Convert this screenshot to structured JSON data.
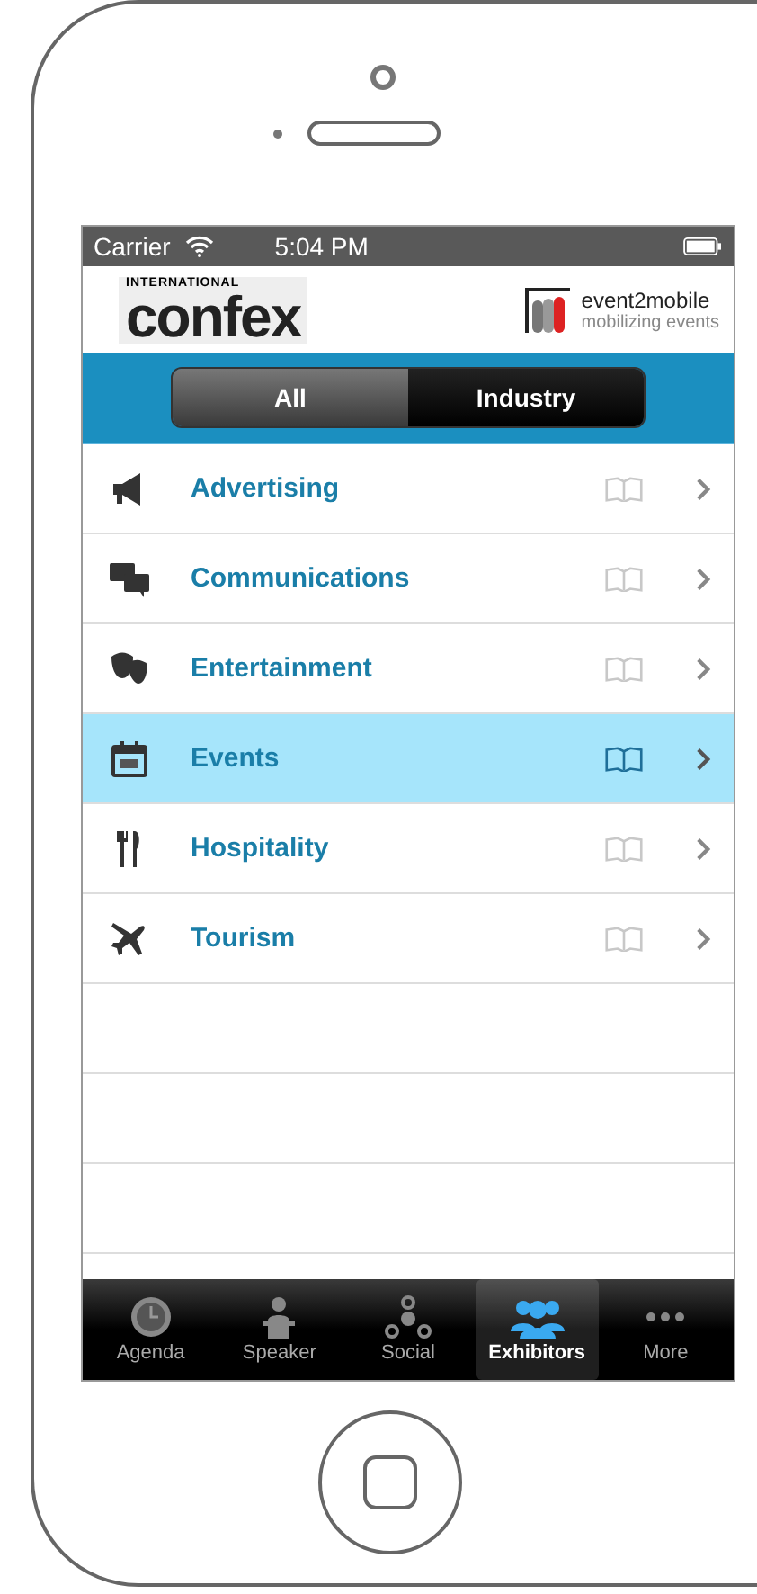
{
  "status_bar": {
    "carrier": "Carrier",
    "time": "5:04 PM"
  },
  "header": {
    "logo_small": "INTERNATIONAL",
    "logo_big": "confex",
    "partner_name": "event2mobile",
    "partner_tagline": "mobilizing events"
  },
  "segments": [
    {
      "label": "All",
      "selected": false
    },
    {
      "label": "Industry",
      "selected": true
    }
  ],
  "categories": [
    {
      "label": "Advertising",
      "selected": false
    },
    {
      "label": "Communications",
      "selected": false
    },
    {
      "label": "Entertainment",
      "selected": false
    },
    {
      "label": "Events",
      "selected": true
    },
    {
      "label": "Hospitality",
      "selected": false
    },
    {
      "label": "Tourism",
      "selected": false
    }
  ],
  "tabs": [
    {
      "label": "Agenda",
      "selected": false
    },
    {
      "label": "Speaker",
      "selected": false
    },
    {
      "label": "Social",
      "selected": false
    },
    {
      "label": "Exhibitors",
      "selected": true
    },
    {
      "label": "More",
      "selected": false
    }
  ]
}
